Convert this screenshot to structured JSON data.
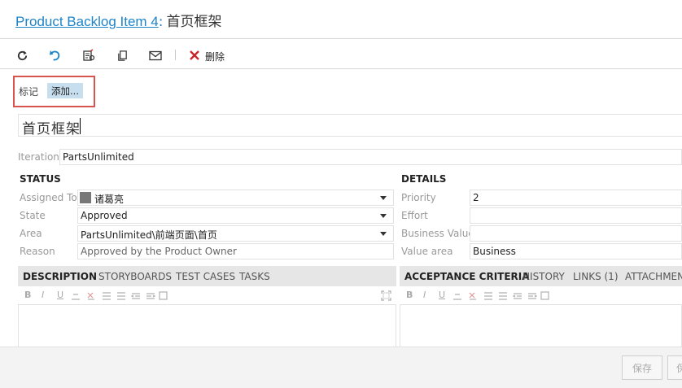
{
  "header": {
    "item_link": "Product Backlog Item 4",
    "separator": ":",
    "item_title": "首页框架"
  },
  "toolbar": {
    "icons": [
      "refresh-icon",
      "undo-icon",
      "copy-template-icon",
      "copy-icon",
      "email-icon",
      "delete-icon"
    ],
    "delete_label": "删除"
  },
  "tags": {
    "label": "标记",
    "add_label": "添加..."
  },
  "title_field": {
    "value": "首页框架"
  },
  "iteration": {
    "label": "Iteration",
    "value": "PartsUnlimited"
  },
  "status": {
    "heading": "STATUS",
    "assigned_to": {
      "label": "Assigned To",
      "value": "诸葛亮"
    },
    "state": {
      "label": "State",
      "value": "Approved"
    },
    "area": {
      "label": "Area",
      "value": "PartsUnlimited\\前端页面\\首页"
    },
    "reason": {
      "label": "Reason",
      "value": "Approved by the Product Owner"
    }
  },
  "details": {
    "heading": "DETAILS",
    "priority": {
      "label": "Priority",
      "value": "2"
    },
    "effort": {
      "label": "Effort",
      "value": ""
    },
    "business_value": {
      "label": "Business Value",
      "value": ""
    },
    "value_area": {
      "label": "Value area",
      "value": "Business"
    }
  },
  "left_tabs": [
    "DESCRIPTION",
    "STORYBOARDS",
    "TEST CASES",
    "TASKS"
  ],
  "right_tabs": [
    "ACCEPTANCE CRITERIA",
    "HISTORY",
    "LINKS (1)",
    "ATTACHMENTS"
  ],
  "rich_text_icons": [
    "B",
    "I",
    "U"
  ],
  "footer": {
    "save_label": "保存",
    "save_close_label": "保"
  },
  "colors": {
    "link": "#1e84c8",
    "highlight_border": "#d9534f",
    "tag_bg": "#c7deef"
  }
}
